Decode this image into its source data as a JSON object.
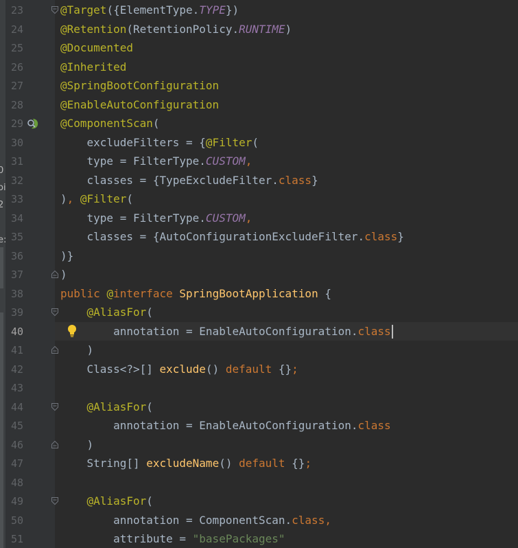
{
  "sidebar_fragments": [
    "0",
    "oi",
    "2",
    "e:"
  ],
  "current_line": "40",
  "colors": {
    "annotation": "#bbb529",
    "keyword": "#cc7832",
    "constant": "#9876aa",
    "string": "#6a8759",
    "method": "#ffc66d",
    "text": "#a9b7c6",
    "line_number": "#606366",
    "background": "#2b2b2b",
    "gutter": "#313335"
  },
  "icons": {
    "gutter_29": "spring-bean-icon",
    "fold": "fold-marker-icon",
    "intention": "lightbulb-icon"
  },
  "lines": [
    {
      "n": "23",
      "fold": "open",
      "tokens": [
        [
          "ann",
          "@Target"
        ],
        [
          "plain",
          "({ElementType."
        ],
        [
          "const",
          "TYPE"
        ],
        [
          "plain",
          "})"
        ]
      ]
    },
    {
      "n": "24",
      "tokens": [
        [
          "ann",
          "@Retention"
        ],
        [
          "plain",
          "(RetentionPolicy."
        ],
        [
          "const",
          "RUNTIME"
        ],
        [
          "plain",
          ")"
        ]
      ]
    },
    {
      "n": "25",
      "tokens": [
        [
          "ann",
          "@Documented"
        ]
      ]
    },
    {
      "n": "26",
      "tokens": [
        [
          "ann",
          "@Inherited"
        ]
      ]
    },
    {
      "n": "27",
      "tokens": [
        [
          "ann",
          "@SpringBootConfiguration"
        ]
      ]
    },
    {
      "n": "28",
      "tokens": [
        [
          "ann",
          "@EnableAutoConfiguration"
        ]
      ]
    },
    {
      "n": "29",
      "gicon": "spring",
      "tokens": [
        [
          "ann",
          "@ComponentScan"
        ],
        [
          "plain",
          "("
        ]
      ]
    },
    {
      "n": "30",
      "tokens": [
        [
          "plain",
          "    excludeFilters = {"
        ],
        [
          "ann",
          "@Filter"
        ],
        [
          "plain",
          "("
        ]
      ]
    },
    {
      "n": "31",
      "tokens": [
        [
          "plain",
          "    type = FilterType."
        ],
        [
          "const",
          "CUSTOM"
        ],
        [
          "kw",
          ","
        ]
      ]
    },
    {
      "n": "32",
      "tokens": [
        [
          "plain",
          "    classes = {TypeExcludeFilter."
        ],
        [
          "kw",
          "class"
        ],
        [
          "plain",
          "}"
        ]
      ]
    },
    {
      "n": "33",
      "tokens": [
        [
          "plain",
          ")"
        ],
        [
          "kw",
          ", "
        ],
        [
          "ann",
          "@Filter"
        ],
        [
          "plain",
          "("
        ]
      ]
    },
    {
      "n": "34",
      "tokens": [
        [
          "plain",
          "    type = FilterType."
        ],
        [
          "const",
          "CUSTOM"
        ],
        [
          "kw",
          ","
        ]
      ]
    },
    {
      "n": "35",
      "tokens": [
        [
          "plain",
          "    classes = {AutoConfigurationExcludeFilter."
        ],
        [
          "kw",
          "class"
        ],
        [
          "plain",
          "}"
        ]
      ]
    },
    {
      "n": "36",
      "tokens": [
        [
          "plain",
          ")}"
        ]
      ]
    },
    {
      "n": "37",
      "fold": "close",
      "tokens": [
        [
          "plain",
          ")"
        ]
      ]
    },
    {
      "n": "38",
      "tokens": [
        [
          "kw",
          "public "
        ],
        [
          "ann",
          "@"
        ],
        [
          "kw",
          "interface "
        ],
        [
          "fn",
          "SpringBootApplication"
        ],
        [
          "plain",
          " {"
        ]
      ]
    },
    {
      "n": "39",
      "fold": "open",
      "tokens": [
        [
          "plain",
          "    "
        ],
        [
          "ann",
          "@AliasFor"
        ],
        [
          "plain",
          "("
        ]
      ]
    },
    {
      "n": "40",
      "current": true,
      "bulb": true,
      "caret": true,
      "tokens": [
        [
          "plain",
          "        annotation = EnableAutoConfiguration."
        ],
        [
          "kw",
          "class"
        ]
      ]
    },
    {
      "n": "41",
      "fold": "close",
      "tokens": [
        [
          "plain",
          "    )"
        ]
      ]
    },
    {
      "n": "42",
      "tokens": [
        [
          "plain",
          "    Class<?>[] "
        ],
        [
          "fn",
          "exclude"
        ],
        [
          "plain",
          "() "
        ],
        [
          "kw",
          "default "
        ],
        [
          "plain",
          "{}"
        ],
        [
          "kw",
          ";"
        ]
      ]
    },
    {
      "n": "43",
      "tokens": []
    },
    {
      "n": "44",
      "fold": "open",
      "tokens": [
        [
          "plain",
          "    "
        ],
        [
          "ann",
          "@AliasFor"
        ],
        [
          "plain",
          "("
        ]
      ]
    },
    {
      "n": "45",
      "tokens": [
        [
          "plain",
          "        annotation = EnableAutoConfiguration."
        ],
        [
          "kw",
          "class"
        ]
      ]
    },
    {
      "n": "46",
      "fold": "close",
      "tokens": [
        [
          "plain",
          "    )"
        ]
      ]
    },
    {
      "n": "47",
      "tokens": [
        [
          "plain",
          "    String[] "
        ],
        [
          "fn",
          "excludeName"
        ],
        [
          "plain",
          "() "
        ],
        [
          "kw",
          "default "
        ],
        [
          "plain",
          "{}"
        ],
        [
          "kw",
          ";"
        ]
      ]
    },
    {
      "n": "48",
      "tokens": []
    },
    {
      "n": "49",
      "fold": "open",
      "tokens": [
        [
          "plain",
          "    "
        ],
        [
          "ann",
          "@AliasFor"
        ],
        [
          "plain",
          "("
        ]
      ]
    },
    {
      "n": "50",
      "tokens": [
        [
          "plain",
          "        annotation = ComponentScan."
        ],
        [
          "kw",
          "class,"
        ]
      ]
    },
    {
      "n": "51",
      "tokens": [
        [
          "plain",
          "        attribute = "
        ],
        [
          "str",
          "\"basePackages\""
        ]
      ]
    }
  ]
}
